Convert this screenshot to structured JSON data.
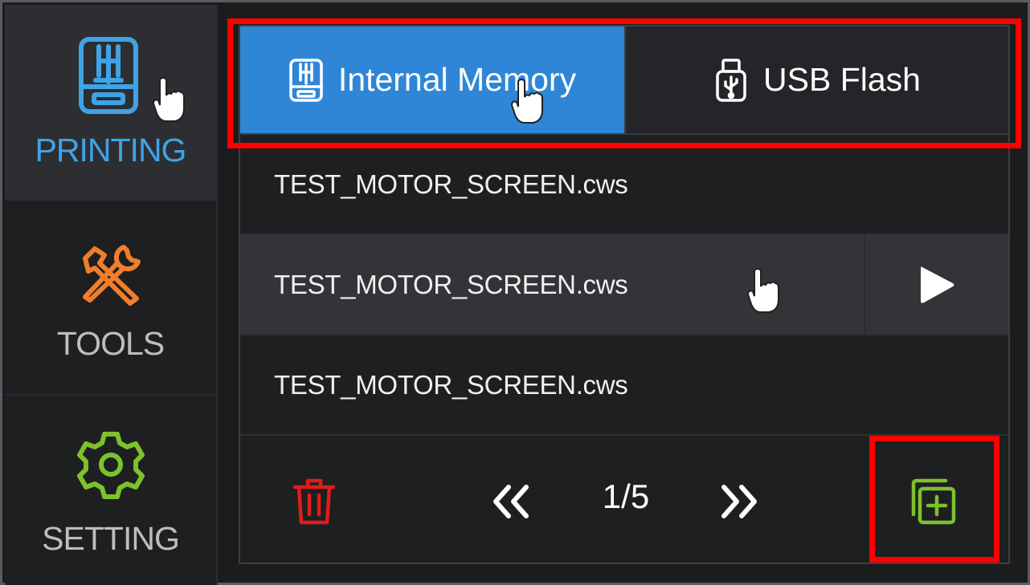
{
  "sidebar": {
    "items": [
      {
        "label": "PRINTING",
        "icon": "printer-icon",
        "active": true,
        "color": "#3fa3e6"
      },
      {
        "label": "TOOLS",
        "icon": "tools-icon",
        "active": false,
        "color": "#f07e2a"
      },
      {
        "label": "SETTING",
        "icon": "gear-icon",
        "active": false,
        "color": "#7cc22a"
      }
    ]
  },
  "tabs": [
    {
      "label": "Internal Memory",
      "icon": "printer-icon",
      "active": true
    },
    {
      "label": "USB Flash",
      "icon": "usb-icon",
      "active": false
    }
  ],
  "files": [
    {
      "name": "TEST_MOTOR_SCREEN.cws",
      "selected": false
    },
    {
      "name": "TEST_MOTOR_SCREEN.cws",
      "selected": true
    },
    {
      "name": "TEST_MOTOR_SCREEN.cws",
      "selected": false
    }
  ],
  "pagination": {
    "current": "1/5",
    "prev_icon": "double-chevron-left-icon",
    "next_icon": "double-chevron-right-icon"
  },
  "actions": {
    "delete_icon": "trash-icon",
    "play_icon": "play-icon",
    "add_icon": "add-copy-icon"
  },
  "colors": {
    "accent_blue": "#2f86d6",
    "printing_blue": "#3fa3e6",
    "tools_orange": "#f07e2a",
    "setting_green": "#7cc22a",
    "delete_red": "#e11b1b",
    "highlight_red": "#ff0000"
  }
}
